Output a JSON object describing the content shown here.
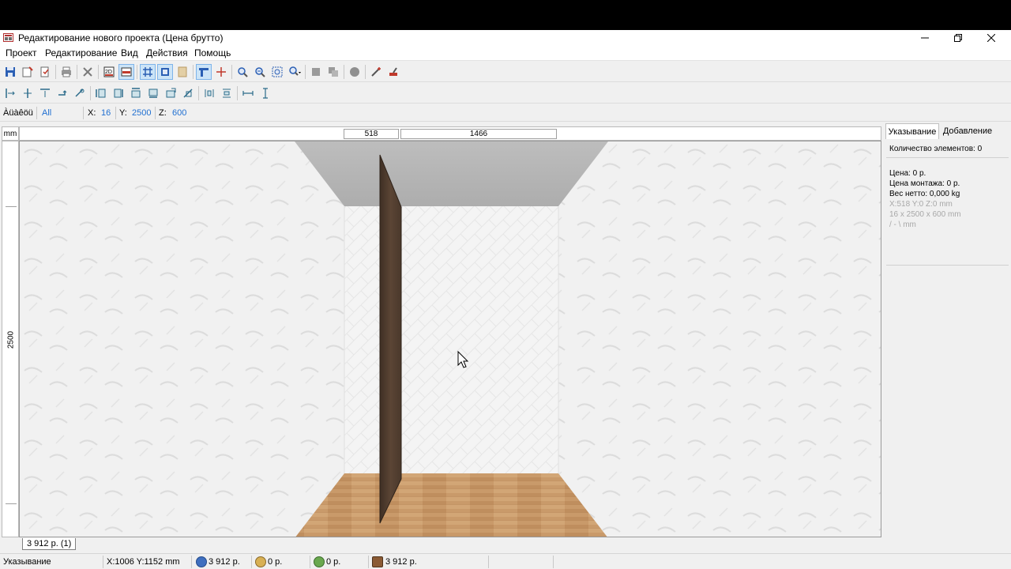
{
  "window": {
    "title": "Редактирование нового проекта (Цена брутто)"
  },
  "menu": [
    "Проект",
    "Редактирование",
    "Вид",
    "Действия",
    "Помощь"
  ],
  "toolbar1": [
    {
      "name": "save-icon",
      "active": false
    },
    {
      "name": "open-icon",
      "active": false
    },
    {
      "name": "new-icon",
      "active": false
    },
    {
      "name": "print-icon",
      "active": false
    },
    {
      "name": "delete-icon",
      "active": false
    },
    {
      "name": "view-2d-icon",
      "active": false
    },
    {
      "name": "view-front-icon",
      "active": true
    },
    {
      "name": "grid-icon",
      "active": true
    },
    {
      "name": "frame-icon",
      "active": true
    },
    {
      "name": "texture-icon",
      "active": false
    },
    {
      "name": "snap-icon",
      "active": true
    },
    {
      "name": "crosshair-icon",
      "active": false
    },
    {
      "name": "zoom-in-icon",
      "active": false
    },
    {
      "name": "zoom-out-icon",
      "active": false
    },
    {
      "name": "zoom-fit-icon",
      "active": false
    },
    {
      "name": "zoom-menu-icon",
      "active": false
    },
    {
      "name": "box-icon",
      "active": false
    },
    {
      "name": "boxes-icon",
      "active": false
    },
    {
      "name": "sphere-icon",
      "active": false
    },
    {
      "name": "wand-icon",
      "active": false
    },
    {
      "name": "paint-icon",
      "active": false
    }
  ],
  "toolbar2": [
    "align-left-icon",
    "align-center-h-icon",
    "align-top-icon",
    "rotate-icon",
    "mirror-icon",
    "move-left-icon",
    "move-right-icon",
    "move-up-icon",
    "move-down-icon",
    "resize-icon",
    "cut-icon",
    "distribute-h-icon",
    "distribute-v-icon",
    "dimension-icon",
    "dimension-v-icon"
  ],
  "coords": {
    "mode_label": "Àüàêöü",
    "filter": "All",
    "x_label": "X:",
    "x": "16",
    "y_label": "Y:",
    "y": "2500",
    "z_label": "Z:",
    "z": "600"
  },
  "rulers": {
    "unit": "mm",
    "h_left": "518",
    "h_width": "1466",
    "v_height": "2500"
  },
  "project_tab": "3 912 р. (1)",
  "side_panel": {
    "tabs": [
      "Указывание",
      "Добавление"
    ],
    "count_text": "Количество элементов: 0",
    "price": "Цена:  0 р.",
    "install_price": "Цена монтажа:  0 р.",
    "weight": "Вес нетто:  0,000 kg",
    "position": "X:518  Y:0  Z:0 mm",
    "dimensions": "16 x 2500 x 600 mm",
    "angle": "/ - \\ mm"
  },
  "status": {
    "mode": "Указывание",
    "cursor": "X:1006  Y:1152  mm",
    "total": "3 912 р.",
    "install": "0 р.",
    "extra": "0 р.",
    "materials": "3 912 р."
  },
  "colors": {
    "accent": "#1f6fd1",
    "panel_board": "#5b4535",
    "floor": "#c99a6a",
    "ceiling": "#b8b8b8"
  }
}
